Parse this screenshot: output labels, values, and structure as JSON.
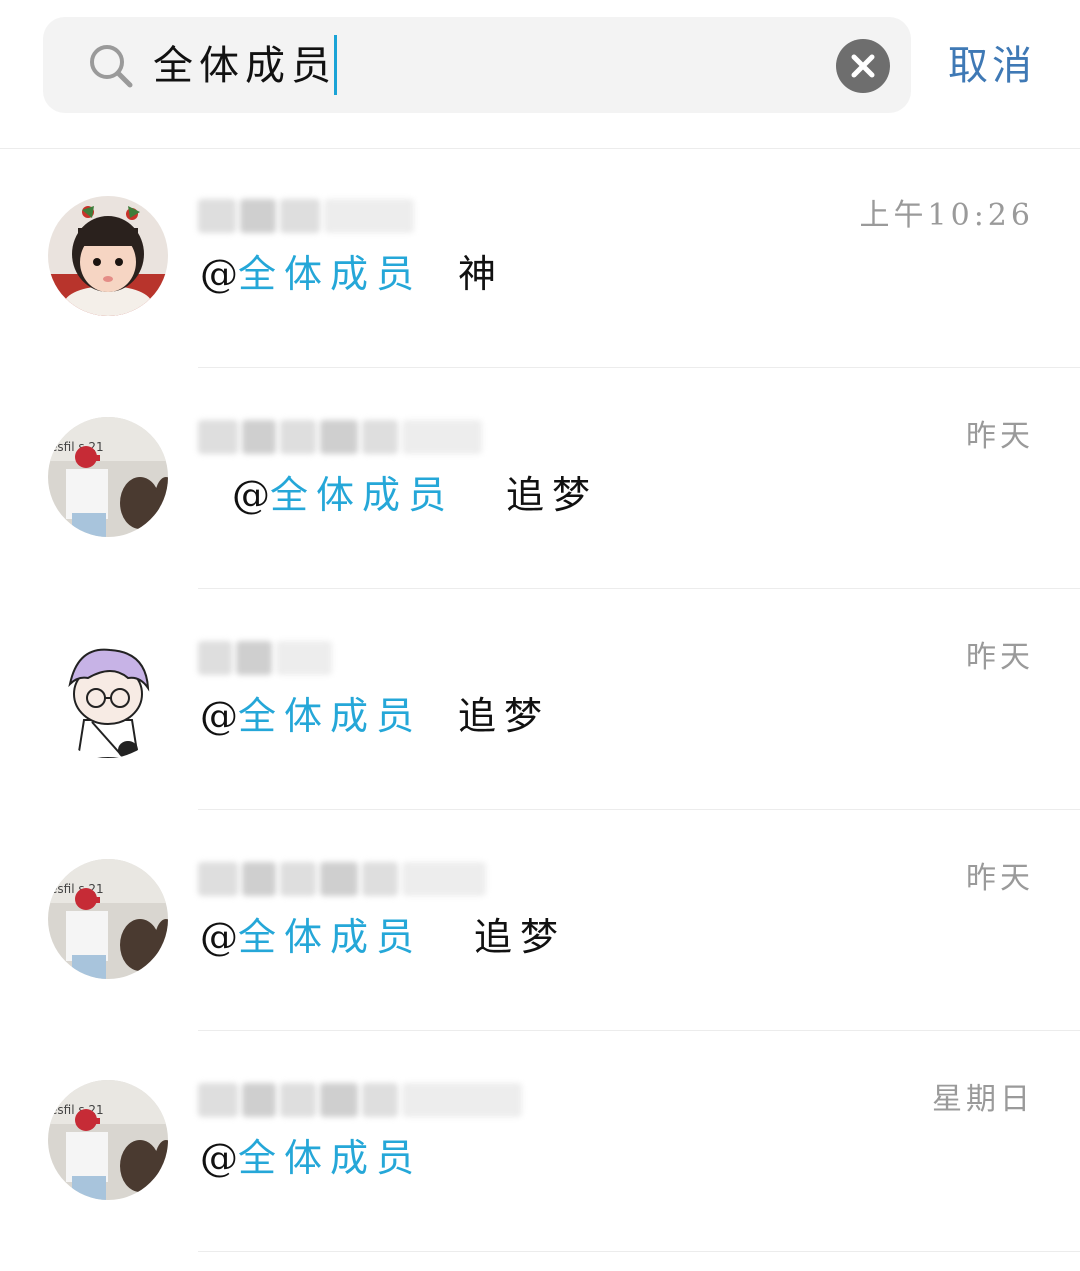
{
  "search": {
    "query": "全体成员",
    "cancel_label": "取消"
  },
  "results": [
    {
      "time": "上午10:26",
      "at": "@",
      "keyword": "全体成员",
      "rest": "神"
    },
    {
      "time": "昨天",
      "at": "@",
      "keyword": "全体成员",
      "rest": "追梦"
    },
    {
      "time": "昨天",
      "at": "@",
      "keyword": "全体成员",
      "rest": "追梦"
    },
    {
      "time": "昨天",
      "at": "@",
      "keyword": "全体成员",
      "rest": "追梦"
    },
    {
      "time": "星期日",
      "at": "@",
      "keyword": "全体成员",
      "rest": ""
    }
  ],
  "colors": {
    "accent": "#25a7d8",
    "cancel": "#3f79b5",
    "time": "#9a9a9a",
    "search_bg": "#f3f3f3"
  }
}
